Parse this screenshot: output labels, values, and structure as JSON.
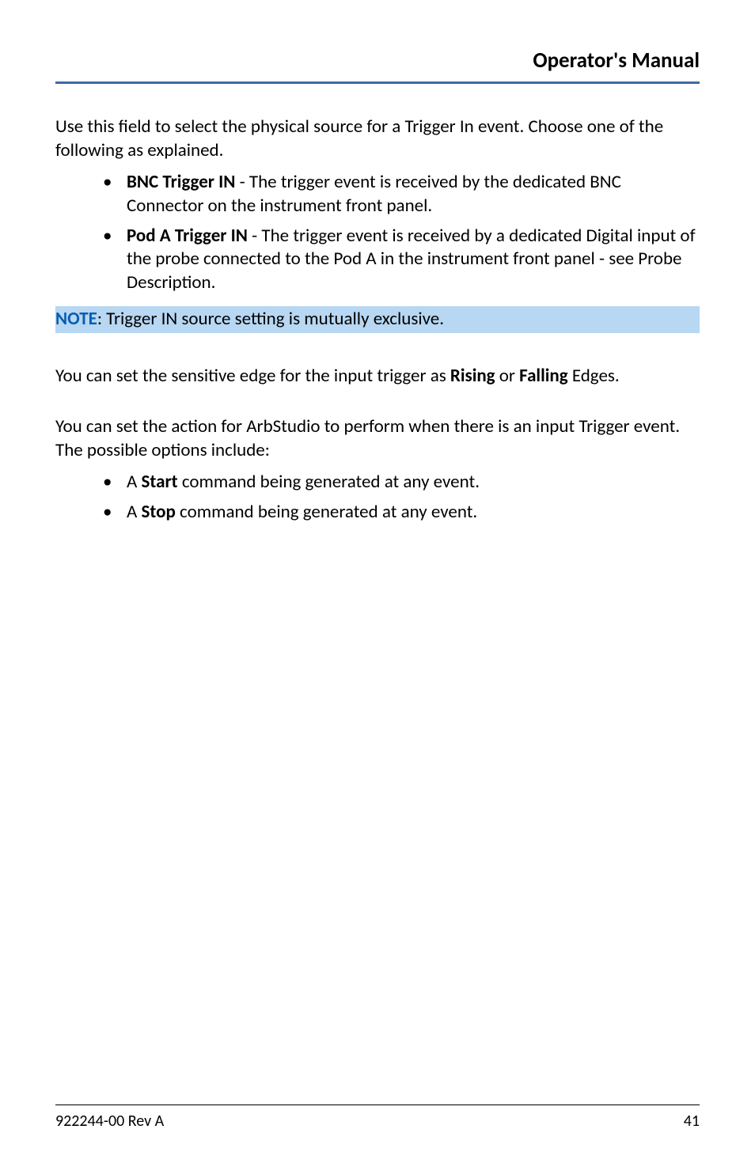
{
  "header": {
    "title": "Operator's Manual"
  },
  "intro": "Use this field to select the physical source for a Trigger In event. Choose one of the following as explained.",
  "source_list": [
    {
      "term": "BNC Trigger IN",
      "desc": " - The trigger event is received by the dedicated BNC Connector on the instrument front panel."
    },
    {
      "term": "Pod A Trigger IN",
      "desc": " - The trigger event is received by a dedicated Digital input of the probe connected to the Pod A in the instrument front panel - see Probe Description."
    }
  ],
  "note": {
    "label": "NOTE",
    "text": ": Trigger IN source setting is mutually exclusive."
  },
  "edge": {
    "pre": "You can set the sensitive edge for the input trigger as ",
    "b1": "Rising",
    "mid": " or  ",
    "b2": "Falling",
    "post": " Edges."
  },
  "action_intro": "You can set the action for ArbStudio to perform when there is an input Trigger event. The possible options include:",
  "action_list": [
    {
      "pre": "A ",
      "term": "Start",
      "post": " command being generated at any event."
    },
    {
      "pre": "A ",
      "term": "Stop",
      "post": " command being generated at any event."
    }
  ],
  "footer": {
    "rev": "922244-00 Rev A",
    "page": "41"
  }
}
